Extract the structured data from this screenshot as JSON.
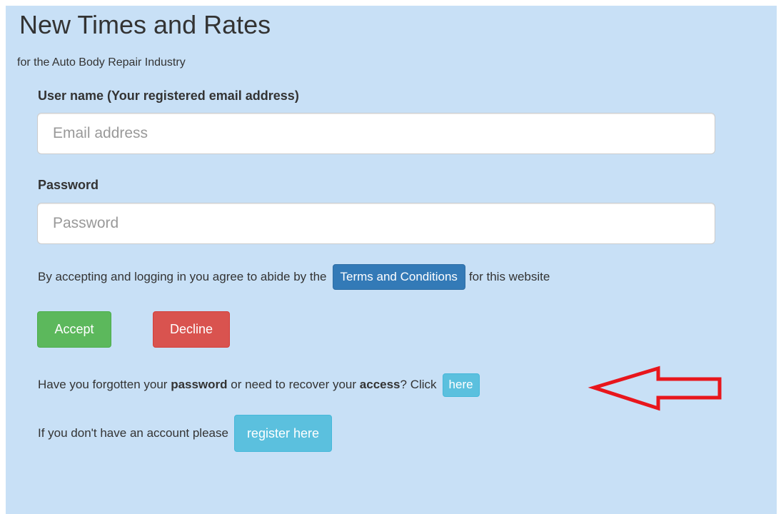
{
  "header": {
    "title": "New Times and Rates",
    "subtitle": "for the Auto Body Repair Industry"
  },
  "login_form": {
    "username_label": "User name (Your registered email address)",
    "email_placeholder": "Email address",
    "email_value": "",
    "password_label": "Password",
    "password_placeholder": "Password",
    "password_value": ""
  },
  "terms": {
    "text_before": "By accepting and logging in you agree to abide by the",
    "button_label": "Terms and Conditions",
    "text_after": "for this website"
  },
  "actions": {
    "accept_label": "Accept",
    "decline_label": "Decline"
  },
  "recovery": {
    "text_1": "Have you forgotten your",
    "bold_1": "password",
    "text_2": "or need to recover your",
    "bold_2": "access",
    "text_3": "? Click",
    "button_label": "here"
  },
  "register": {
    "text": "If you don't have an account please",
    "button_label": "register here"
  },
  "colors": {
    "panel_background": "#c8e0f6",
    "primary": "#337ab7",
    "success": "#5cb85c",
    "danger": "#d9534f",
    "info": "#5bc0de",
    "annotation_arrow": "#e8161c"
  },
  "annotation": {
    "icon": "red-arrow-pointing-left-icon"
  }
}
